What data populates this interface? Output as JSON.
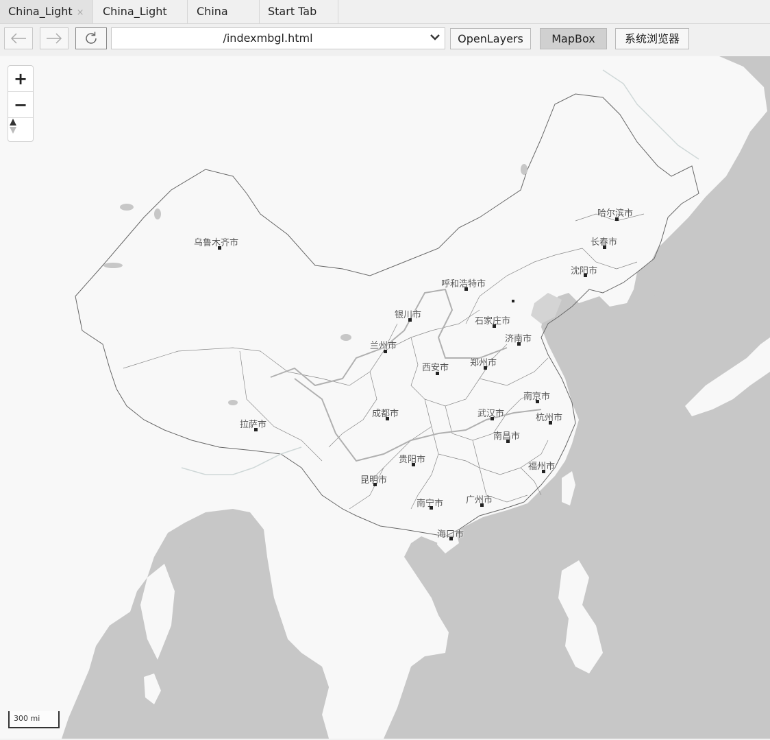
{
  "tabs": [
    {
      "label": "China_Light",
      "active": true,
      "close": "×"
    },
    {
      "label": "China_Light"
    },
    {
      "label": "China"
    },
    {
      "label": "Start Tab"
    }
  ],
  "toolbar": {
    "back_icon": "back-arrow-icon",
    "forward_icon": "forward-arrow-icon",
    "refresh_icon": "refresh-icon",
    "url": "/indexmbgl.html",
    "url_dropdown_icon": "chevron-down-icon",
    "buttons": [
      "OpenLayers",
      "MapBox",
      "系统浏览器"
    ],
    "active_button": "MapBox"
  },
  "map": {
    "zoom_in": "+",
    "zoom_out": "−",
    "compass_icon": "compass-icon",
    "scale_label": "300 mi",
    "cities": [
      {
        "name": "哈尔滨市"
      },
      {
        "name": "长春市"
      },
      {
        "name": "沈阳市"
      },
      {
        "name": "乌鲁木齐市"
      },
      {
        "name": "呼和浩特市"
      },
      {
        "name": "银川市"
      },
      {
        "name": "石家庄市"
      },
      {
        "name": "济南市"
      },
      {
        "name": "兰州市"
      },
      {
        "name": "西安市"
      },
      {
        "name": "郑州市"
      },
      {
        "name": "南京市"
      },
      {
        "name": "成都市"
      },
      {
        "name": "武汉市"
      },
      {
        "name": "杭州市"
      },
      {
        "name": "拉萨市"
      },
      {
        "name": "南昌市"
      },
      {
        "name": "贵阳市"
      },
      {
        "name": "福州市"
      },
      {
        "name": "昆明市"
      },
      {
        "name": "南宁市"
      },
      {
        "name": "广州市"
      },
      {
        "name": "海口市"
      }
    ],
    "colors": {
      "sea": "#c7c7c7",
      "land": "#f8f8f8",
      "border": "#666666"
    }
  }
}
